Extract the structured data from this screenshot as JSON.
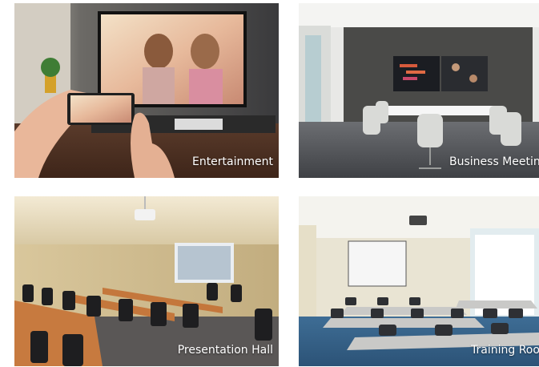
{
  "tiles": [
    {
      "caption": "Entertainment"
    },
    {
      "caption": "Business Meeting"
    },
    {
      "caption": "Presentation Hall"
    },
    {
      "caption": "Training Room"
    }
  ]
}
